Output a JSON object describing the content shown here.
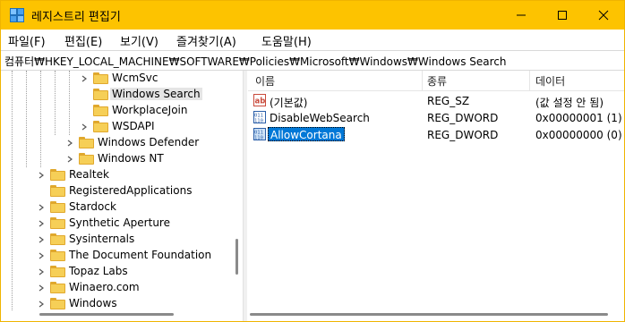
{
  "window": {
    "title": "레지스트리 편집기",
    "colors": {
      "titlebar": "#fdc300",
      "selection": "#0078d7"
    }
  },
  "menu": [
    "파일(F)",
    "편집(E)",
    "보기(V)",
    "즐겨찾기(A)",
    "도움말(H)"
  ],
  "address": "컴퓨터₩HKEY_LOCAL_MACHINE₩SOFTWARE₩Policies₩Microsoft₩Windows₩Windows Search",
  "tree": [
    {
      "label": "WcmSvc",
      "expandable": true,
      "selected": false
    },
    {
      "label": "Windows Search",
      "expandable": false,
      "selected": true
    },
    {
      "label": "WorkplaceJoin",
      "expandable": false,
      "selected": false
    },
    {
      "label": "WSDAPI",
      "expandable": true,
      "selected": false
    },
    {
      "label": "Windows Defender",
      "expandable": true,
      "selected": false
    },
    {
      "label": "Windows NT",
      "expandable": true,
      "selected": false
    },
    {
      "label": "Realtek",
      "expandable": true,
      "selected": false
    },
    {
      "label": "RegisteredApplications",
      "expandable": false,
      "selected": false
    },
    {
      "label": "Stardock",
      "expandable": true,
      "selected": false
    },
    {
      "label": "Synthetic Aperture",
      "expandable": true,
      "selected": false
    },
    {
      "label": "Sysinternals",
      "expandable": true,
      "selected": false
    },
    {
      "label": "The Document Foundation",
      "expandable": true,
      "selected": false
    },
    {
      "label": "Topaz Labs",
      "expandable": true,
      "selected": false
    },
    {
      "label": "Winaero.com",
      "expandable": true,
      "selected": false
    },
    {
      "label": "Windows",
      "expandable": true,
      "selected": false
    }
  ],
  "list": {
    "headers": {
      "name": "이름",
      "type": "종류",
      "data": "데이터"
    },
    "rows": [
      {
        "name": "(기본값)",
        "type": "REG_SZ",
        "data": "(값 설정 안 됨)",
        "icon": "string-value-icon",
        "selected": false
      },
      {
        "name": "DisableWebSearch",
        "type": "REG_DWORD",
        "data": "0x00000001 (1)",
        "icon": "dword-value-icon",
        "selected": false
      },
      {
        "name": "AllowCortana",
        "type": "REG_DWORD",
        "data": "0x00000000 (0)",
        "icon": "dword-value-icon",
        "selected": true
      }
    ]
  }
}
